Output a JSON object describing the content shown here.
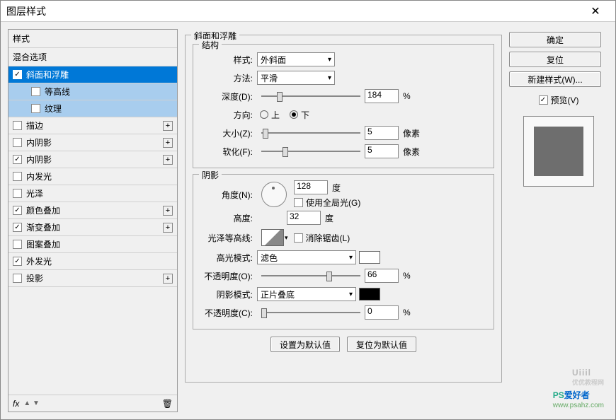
{
  "title": "图层样式",
  "close": "✕",
  "sidebar": {
    "styles": "样式",
    "blend": "混合选项",
    "bevel": "斜面和浮雕",
    "contour": "等高线",
    "texture": "纹理",
    "stroke": "描边",
    "innerShadow1": "内阴影",
    "innerShadow2": "内阴影",
    "innerGlow": "内发光",
    "satin": "光泽",
    "colorOverlay": "颜色叠加",
    "gradOverlay": "渐变叠加",
    "patternOverlay": "图案叠加",
    "outerGlow": "外发光",
    "dropShadow": "投影",
    "fx": "fx"
  },
  "center": {
    "group1": "斜面和浮雕",
    "structure": "结构",
    "style_lbl": "样式:",
    "style_val": "外斜面",
    "technique_lbl": "方法:",
    "technique_val": "平滑",
    "depth_lbl": "深度(D):",
    "depth_val": "184",
    "pct": "%",
    "direction_lbl": "方向:",
    "dir_up": "上",
    "dir_down": "下",
    "size_lbl": "大小(Z):",
    "size_val": "5",
    "px": "像素",
    "soften_lbl": "软化(F):",
    "soften_val": "5",
    "shadow": "阴影",
    "angle_lbl": "角度(N):",
    "angle_val": "128",
    "deg": "度",
    "global": "使用全局光(G)",
    "altitude_lbl": "高度:",
    "altitude_val": "32",
    "gloss_lbl": "光泽等高线:",
    "antialias": "消除锯齿(L)",
    "hilite_lbl": "高光模式:",
    "hilite_val": "滤色",
    "hop_lbl": "不透明度(O):",
    "hop_val": "66",
    "shadowmode_lbl": "阴影模式:",
    "shadowmode_val": "正片叠底",
    "sop_lbl": "不透明度(C):",
    "sop_val": "0",
    "default_btn": "设置为默认值",
    "reset_btn": "复位为默认值"
  },
  "right": {
    "ok": "确定",
    "cancel": "复位",
    "newstyle": "新建样式(W)...",
    "preview": "预览(V)"
  },
  "wm1": "Uiiil",
  "wm1sub": "优优教程网",
  "wm2ps": "PS",
  "wm2rest": "爱好者",
  "wm2url": "www.psahz.com"
}
